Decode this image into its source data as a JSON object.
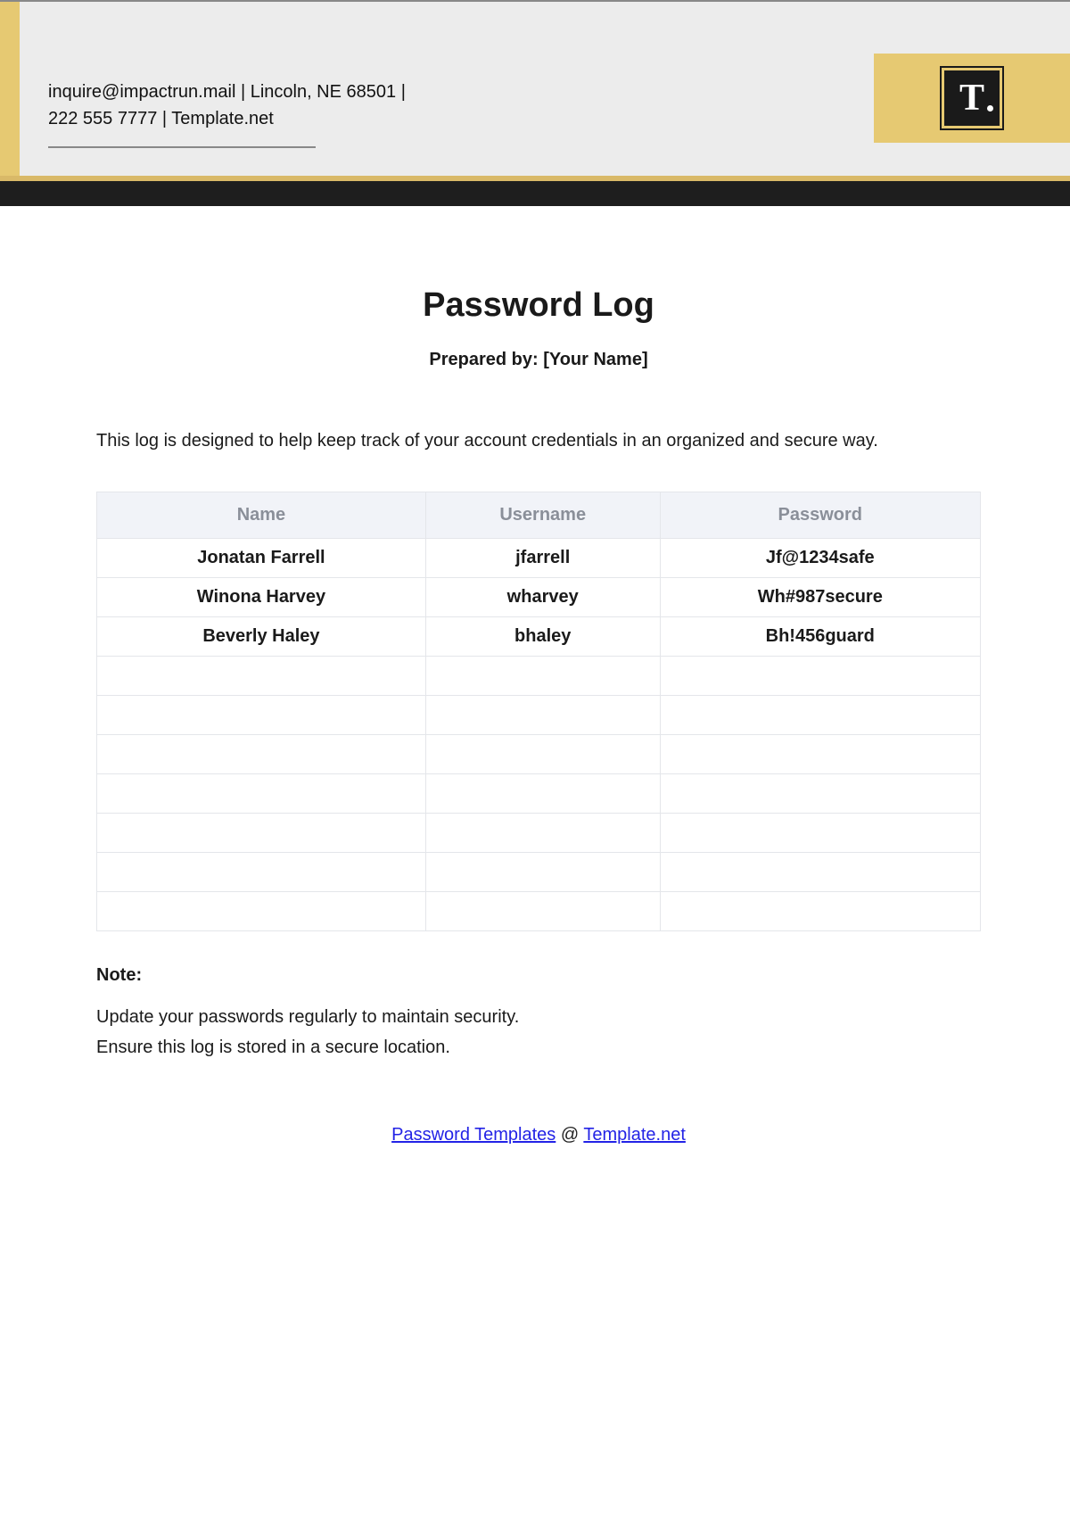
{
  "header": {
    "info_line1": "inquire@impactrun.mail | Lincoln, NE 68501 |",
    "info_line2": "222 555 7777 | Template.net",
    "logo_letter": "T"
  },
  "title": "Password Log",
  "subtitle": "Prepared by: [Your Name]",
  "intro": "This log is designed to help keep track of your account credentials in an organized and secure way.",
  "table": {
    "headers": [
      "Name",
      "Username",
      "Password"
    ],
    "rows": [
      {
        "name": "Jonatan Farrell",
        "username": "jfarrell",
        "password": "Jf@1234safe"
      },
      {
        "name": "Winona Harvey",
        "username": "wharvey",
        "password": "Wh#987secure"
      },
      {
        "name": "Beverly Haley",
        "username": "bhaley",
        "password": "Bh!456guard"
      }
    ],
    "empty_rows": 7
  },
  "note": {
    "heading": "Note:",
    "lines": [
      "Update your passwords regularly to maintain security.",
      "Ensure this log is stored in a secure location."
    ]
  },
  "footer": {
    "link1": "Password Templates",
    "at": " @ ",
    "link2": "Template.net"
  }
}
